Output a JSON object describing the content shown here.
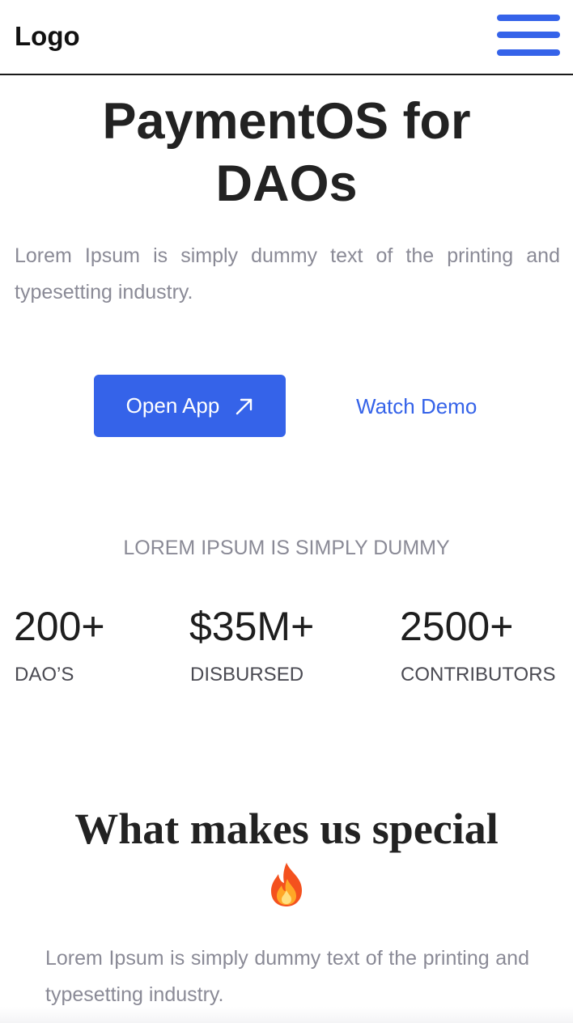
{
  "nav": {
    "logo": "Logo",
    "menu_icon": "hamburger-menu-icon",
    "accent_color": "#3563e9"
  },
  "hero": {
    "title_line1": "PaymentOS for",
    "title_line2": "DAOs",
    "description": "Lorem Ipsum is simply dummy text of the printing and typesetting industry.",
    "primary_button": "Open App",
    "primary_button_icon": "arrow-up-right-icon",
    "secondary_link": "Watch Demo"
  },
  "stats": {
    "caption": "LOREM IPSUM IS SIMPLY DUMMY",
    "items": [
      {
        "value": "200+",
        "label": "DAO’S"
      },
      {
        "value": "$35M+",
        "label": "DISBURSED"
      },
      {
        "value": "2500+",
        "label": "CONTRIBUTORS"
      }
    ]
  },
  "special": {
    "title": "What makes us special",
    "emoji_icon": "fire-icon",
    "description": "Lorem Ipsum is simply dummy text of the printing and typesetting industry."
  }
}
